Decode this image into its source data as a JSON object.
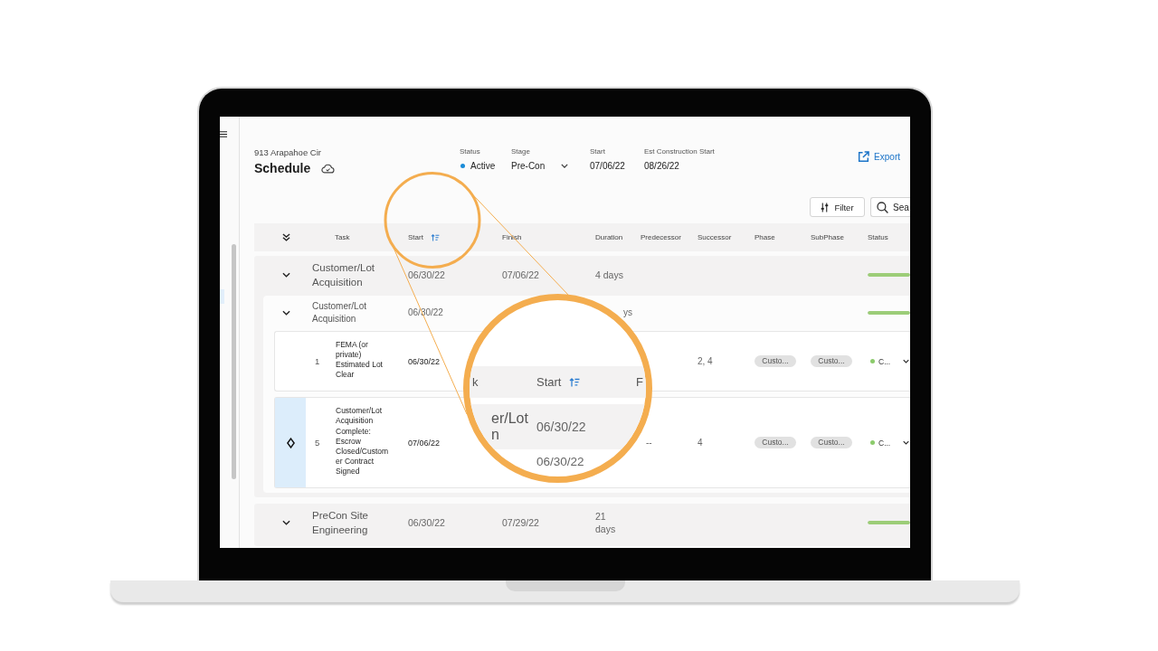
{
  "header": {
    "address": "913 Arapahoe Cir",
    "title": "Schedule"
  },
  "meta": [
    {
      "kind": "status",
      "label": "Status",
      "value": "Active"
    },
    {
      "kind": "select",
      "label": "Stage",
      "value": "Pre-Con"
    },
    {
      "kind": "text",
      "label": "Start",
      "value": "07/06/22"
    },
    {
      "kind": "text",
      "label": "Est Construction Start",
      "value": "08/26/22"
    }
  ],
  "export": "Export",
  "toolbar": {
    "filter": "Filter",
    "search": "Sea"
  },
  "table": {
    "columns": [
      {
        "label": "Task",
        "sorted": false
      },
      {
        "label": "Start",
        "sorted": true
      },
      {
        "label": "Finish",
        "sorted": false
      },
      {
        "label": "Duration",
        "sorted": false
      },
      {
        "label": "Predecessor",
        "sorted": false
      },
      {
        "label": "Successor",
        "sorted": false
      },
      {
        "label": "Phase",
        "sorted": false
      },
      {
        "label": "SubPhase",
        "sorted": false
      },
      {
        "label": "Status",
        "sorted": false
      }
    ],
    "groups": [
      {
        "name": "Customer/Lot Acquisition",
        "expanded": true,
        "start": "06/30/22",
        "finish": "07/06/22",
        "duration": "4 days",
        "level": 1,
        "children": [
          {
            "name": "Customer/Lot Acquisition",
            "expanded": true,
            "start": "06/30/22",
            "duration": "ys",
            "duration_clipped": true,
            "level": 1,
            "children": [
              {
                "kind": "task",
                "number": "1",
                "name": "FEMA (or private) Estimated Lot Clear",
                "start": "06/30/22",
                "successor": "2, 4",
                "phase": "Custo...",
                "subphase": "Custo...",
                "status": "C..."
              },
              {
                "kind": "milestone",
                "number": "5",
                "name": "Customer/Lot Acquisition Complete: Escrow Closed/Customer Contract Signed",
                "start": "07/06/22",
                "predecessor": "--",
                "successor": "4",
                "phase": "Custo...",
                "subphase": "Custo...",
                "status": "C..."
              }
            ]
          }
        ]
      },
      {
        "name": "PreCon Site Engineering",
        "expanded": true,
        "start": "06/30/22",
        "finish": "07/29/22",
        "duration": "21 days",
        "level": 1
      }
    ]
  },
  "magnifier": {
    "columns": [
      {
        "label": "k",
        "sorted": false
      },
      {
        "label": "Start",
        "sorted": true
      },
      {
        "label": "F",
        "sorted": false
      }
    ],
    "rows": [
      {
        "kind": "group",
        "task": [
          "er/Lot",
          "n"
        ],
        "start": "06/30/22"
      },
      {
        "kind": "subgroup",
        "start": "06/30/22"
      }
    ]
  }
}
